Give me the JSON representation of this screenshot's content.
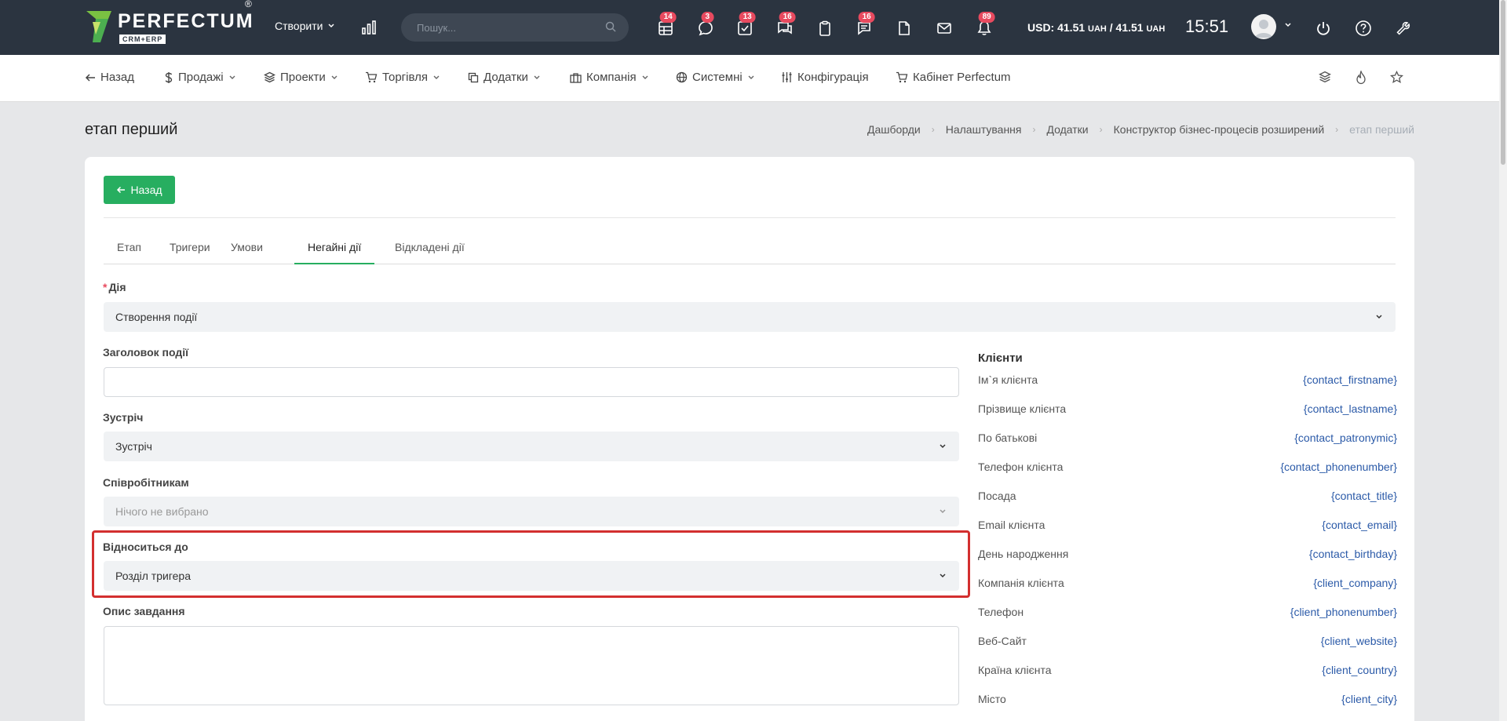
{
  "topbar": {
    "logo": {
      "word": "PERFECTUM",
      "sub": "CRM+ERP",
      "reg": "®"
    },
    "create_label": "Створити",
    "search_placeholder": "Пошук...",
    "badges": [
      "14",
      "3",
      "13",
      "16",
      "16",
      "89"
    ],
    "currency_prefix": "USD: 41.51",
    "currency_unit": "UAH",
    "currency_sep": " / 41.51",
    "clock": "15:51"
  },
  "subnav": {
    "items": [
      {
        "label": "Назад",
        "icon": "arrow-left-icon"
      },
      {
        "label": "Продажі",
        "icon": "dollar-icon"
      },
      {
        "label": "Проекти",
        "icon": "layers-icon"
      },
      {
        "label": "Торгівля",
        "icon": "cart-icon"
      },
      {
        "label": "Додатки",
        "icon": "copy-icon"
      },
      {
        "label": "Компанія",
        "icon": "briefcase-icon"
      },
      {
        "label": "Системні",
        "icon": "globe-icon"
      },
      {
        "label": "Конфігурація",
        "icon": "sliders-icon"
      },
      {
        "label": "Кабінет Perfectum",
        "icon": "cart-icon"
      }
    ]
  },
  "page": {
    "title": "етап перший",
    "breadcrumb": [
      "Дашборди",
      "Налаштування",
      "Додатки",
      "Конструктор бізнес-процесів розширений",
      "етап перший"
    ]
  },
  "card": {
    "back_label": "Назад",
    "tabs": [
      "Етап",
      "Тригери",
      "Умови",
      "Негайні дії",
      "Відкладені дії"
    ],
    "active_tab": "Негайні дії",
    "form": {
      "action_label": "Дія",
      "action_value": "Створення події",
      "title_label": "Заголовок події",
      "title_value": "",
      "meeting_label": "Зустріч",
      "meeting_value": "Зустріч",
      "staff_label": "Співробітникам",
      "staff_placeholder": "Нічого не вибрано",
      "relates_label": "Відноситься до",
      "relates_value": "Розділ тригера",
      "desc_label": "Опис завдання",
      "desc_value": ""
    },
    "placeholders": {
      "title": "Клієнти",
      "rows": [
        {
          "label": "Ім`я клієнта",
          "code": "{contact_firstname}"
        },
        {
          "label": "Прізвище клієнта",
          "code": "{contact_lastname}"
        },
        {
          "label": "По батькові",
          "code": "{contact_patronymic}"
        },
        {
          "label": "Телефон клієнта",
          "code": "{contact_phonenumber}"
        },
        {
          "label": "Посада",
          "code": "{contact_title}"
        },
        {
          "label": "Email клієнта",
          "code": "{contact_email}"
        },
        {
          "label": "День народження",
          "code": "{contact_birthday}"
        },
        {
          "label": "Компанія клієнта",
          "code": "{client_company}"
        },
        {
          "label": "Телефон",
          "code": "{client_phonenumber}"
        },
        {
          "label": "Веб-Сайт",
          "code": "{client_website}"
        },
        {
          "label": "Країна клієнта",
          "code": "{client_country}"
        },
        {
          "label": "Місто",
          "code": "{client_city}"
        }
      ]
    }
  },
  "colors": {
    "topbar_bg": "#2b3440",
    "accent_green": "#27ae60",
    "badge_red": "#e84a5f",
    "highlight_red": "#d32f2f",
    "link_blue": "#2b5aa8"
  }
}
